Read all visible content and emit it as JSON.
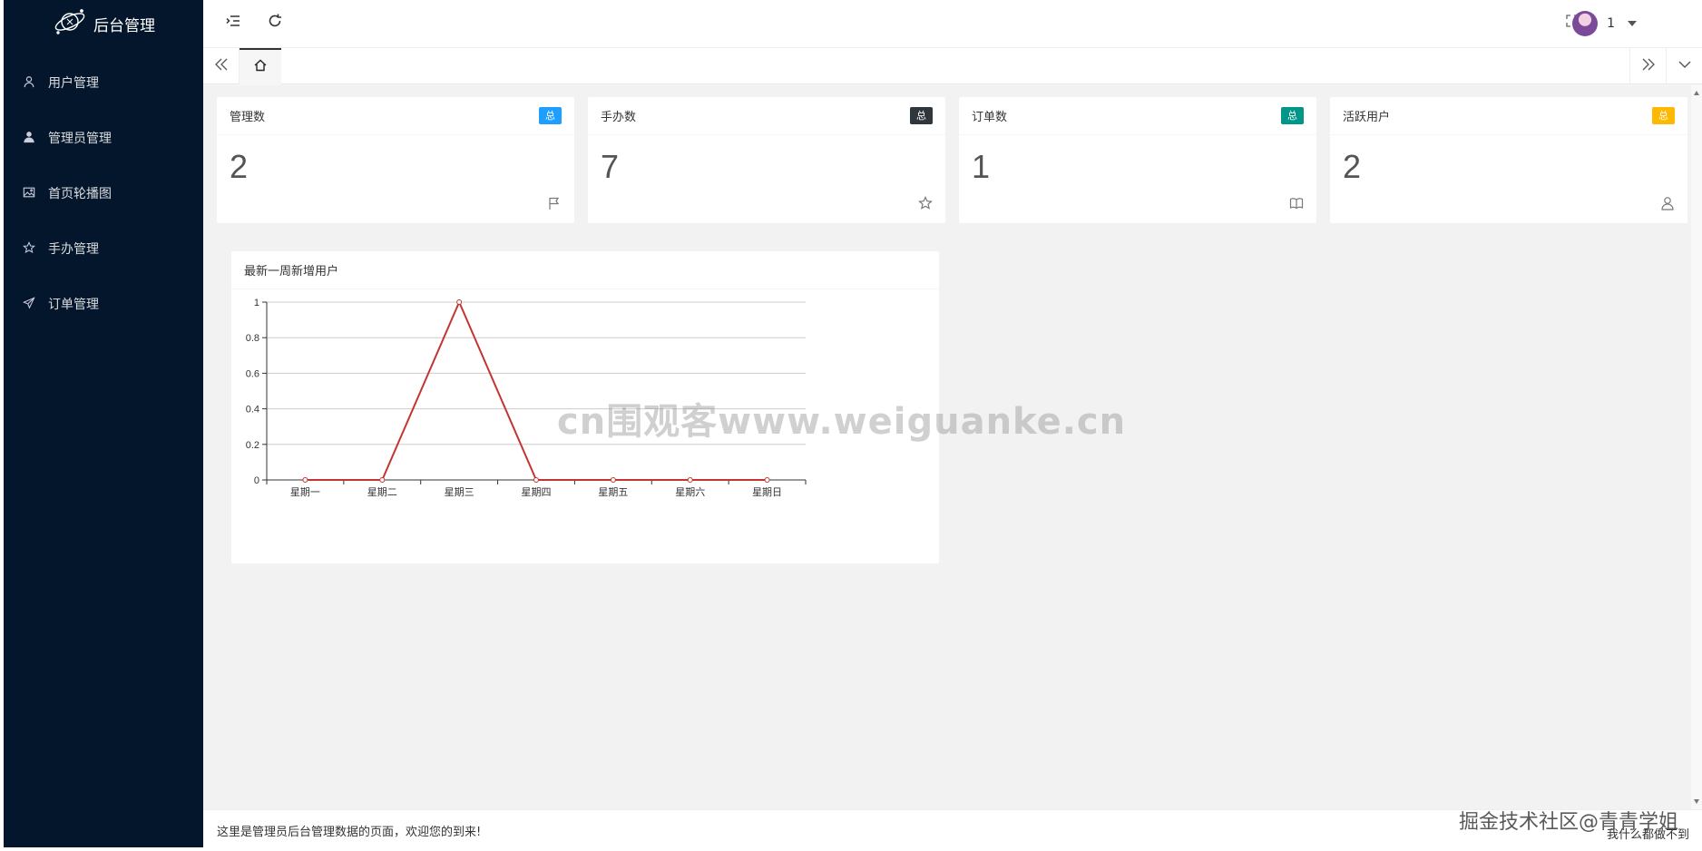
{
  "sidebar": {
    "logo_text": "后台管理",
    "items": [
      {
        "label": "用户管理",
        "icon": "user-icon"
      },
      {
        "label": "管理员管理",
        "icon": "admin-user-icon"
      },
      {
        "label": "首页轮播图",
        "icon": "image-icon"
      },
      {
        "label": "手办管理",
        "icon": "star-icon"
      },
      {
        "label": "订单管理",
        "icon": "send-icon"
      }
    ]
  },
  "header": {
    "user_name": "1"
  },
  "cards": [
    {
      "title": "管理数",
      "badge": "总",
      "badge_color": "#1e9fff",
      "value": "2",
      "icon": "flag-icon"
    },
    {
      "title": "手办数",
      "badge": "总",
      "badge_color": "#2f363c",
      "value": "7",
      "icon": "star-icon"
    },
    {
      "title": "订单数",
      "badge": "总",
      "badge_color": "#009688",
      "value": "1",
      "icon": "book-icon"
    },
    {
      "title": "活跃用户",
      "badge": "总",
      "badge_color": "#ffb800",
      "value": "2",
      "icon": "user-outline-icon"
    }
  ],
  "chart_data": {
    "type": "line",
    "title": "最新一周新增用户",
    "categories": [
      "星期一",
      "星期二",
      "星期三",
      "星期四",
      "星期五",
      "星期六",
      "星期日"
    ],
    "series": [
      {
        "values": [
          0,
          0,
          1,
          0,
          0,
          0,
          0
        ]
      }
    ],
    "ylim": [
      0,
      1
    ],
    "yticks": [
      "0",
      "0.2",
      "0.4",
      "0.6",
      "0.8",
      "1"
    ],
    "grid": true,
    "line_color": "#c23531"
  },
  "watermark": "cn围观客www.weiguanke.cn",
  "footer": {
    "text": "这里是管理员后台管理数据的页面，欢迎您的到来!",
    "right_text": "我什么都做不到"
  },
  "corner_watermark": "掘金技术社区@青青学姐"
}
